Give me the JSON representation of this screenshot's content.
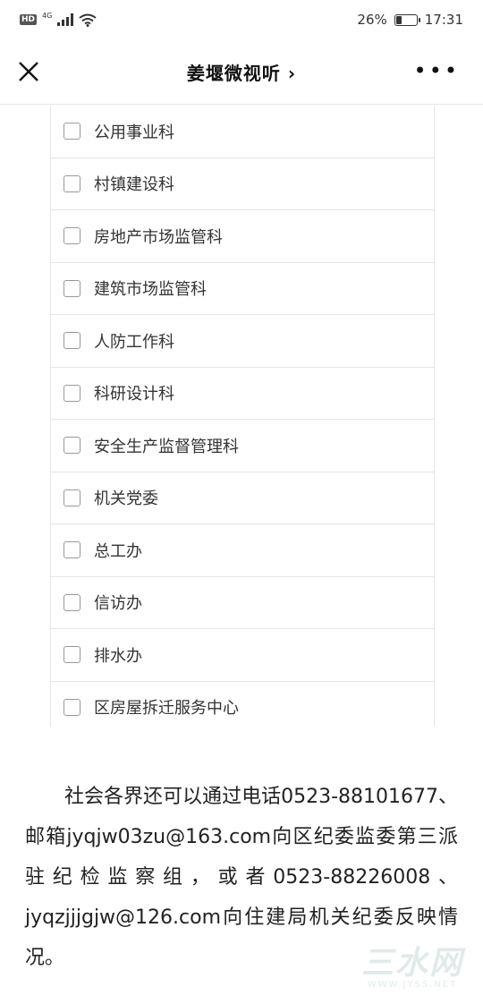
{
  "status_bar": {
    "hd": "HD",
    "network": "4G",
    "battery": "26%",
    "battery_level": 0.26,
    "time": "17:31"
  },
  "nav": {
    "title": "姜堰微视听 ›"
  },
  "department_list": [
    {
      "label": "公用事业科",
      "checked": false
    },
    {
      "label": "村镇建设科",
      "checked": false
    },
    {
      "label": "房地产市场监管科",
      "checked": false
    },
    {
      "label": "建筑市场监管科",
      "checked": false
    },
    {
      "label": "人防工作科",
      "checked": false
    },
    {
      "label": "科研设计科",
      "checked": false
    },
    {
      "label": "安全生产监督管理科",
      "checked": false
    },
    {
      "label": "机关党委",
      "checked": false
    },
    {
      "label": "总工办",
      "checked": false
    },
    {
      "label": "信访办",
      "checked": false
    },
    {
      "label": "排水办",
      "checked": false
    },
    {
      "label": "区房屋拆迁服务中心",
      "checked": false
    }
  ],
  "article": {
    "paragraph": "社会各界还可以通过电话0523-88101677、邮箱jyqjw03zu@163.com向区纪委监委第三派驻纪检监察组，或者0523-88226008、jyqzjjjgjw@126.com向住建局机关纪委反映情况。"
  },
  "watermark": {
    "main": "三水网",
    "sub": "WWW.JYSS.NET"
  }
}
